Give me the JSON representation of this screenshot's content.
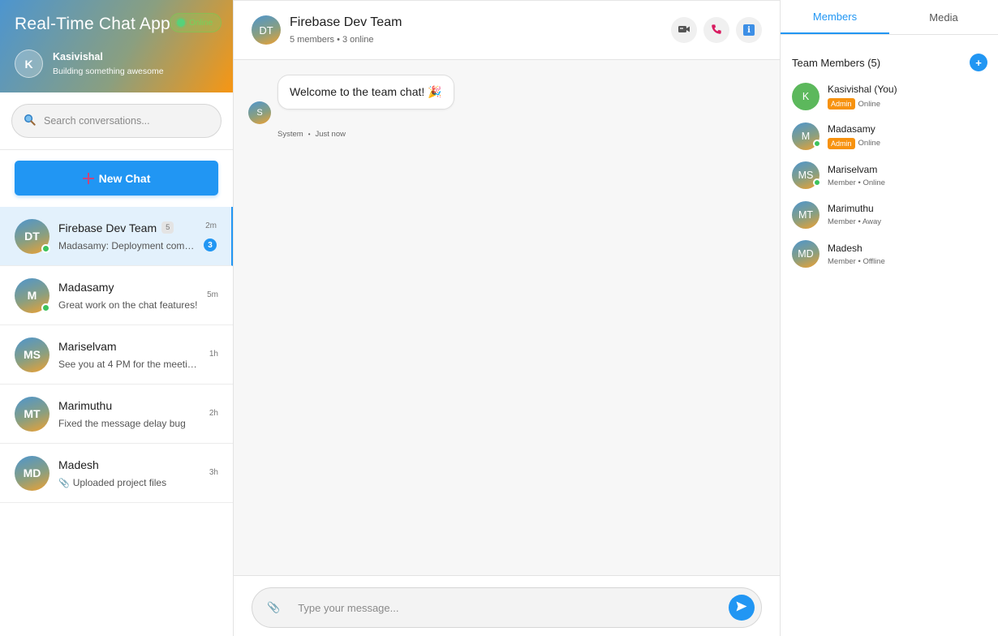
{
  "app": {
    "title": "Real-Time Chat App",
    "connection_status": "Online",
    "user": {
      "initial": "K",
      "name": "Kasivishal",
      "status": "Building something awesome"
    }
  },
  "search": {
    "placeholder": "Search conversations..."
  },
  "new_chat": {
    "label": "New Chat"
  },
  "conversations": [
    {
      "initials": "DT",
      "name": "Firebase Dev Team",
      "member_count": "5",
      "last_message": "Madasamy: Deployment comp...",
      "time": "2m",
      "unread": "3",
      "online": true,
      "active": true
    },
    {
      "initials": "M",
      "name": "Madasamy",
      "last_message": "Great work on the chat features!",
      "time": "5m",
      "online": true
    },
    {
      "initials": "MS",
      "name": "Mariselvam",
      "last_message": "See you at 4 PM for the meeting",
      "time": "1h"
    },
    {
      "initials": "MT",
      "name": "Marimuthu",
      "last_message": "Fixed the message delay bug",
      "time": "2h"
    },
    {
      "initials": "MD",
      "name": "Madesh",
      "last_message": "Uploaded project files",
      "time": "3h"
    }
  ],
  "chat": {
    "initials": "DT",
    "name": "Firebase Dev Team",
    "subtitle": "5 members • 3 online",
    "messages": [
      {
        "sender_initial": "S",
        "text": "Welcome to the team chat! 🎉",
        "sender": "System",
        "time": "Just now"
      }
    ],
    "composer_placeholder": "Type your message..."
  },
  "panel": {
    "tabs": [
      "Members",
      "Media"
    ],
    "members_title": "Team Members (5)",
    "members": [
      {
        "initials": "K",
        "name": "Kasivishal (You)",
        "badge": "Admin",
        "status": "Online"
      },
      {
        "initials": "M",
        "name": "Madasamy",
        "badge": "Admin",
        "status": "Online"
      },
      {
        "initials": "MS",
        "name": "Mariselvam",
        "status": "Member • Online"
      },
      {
        "initials": "MT",
        "name": "Marimuthu",
        "status": "Member • Away"
      },
      {
        "initials": "MD",
        "name": "Madesh",
        "status": "Member • Offline"
      }
    ]
  },
  "colors": {
    "accent": "#2196f3",
    "admin_badge": "#f7920f",
    "online": "#3ec25c"
  },
  "icons": {
    "search": "search-icon",
    "new_chat": "plus-icon",
    "video": "video-camera-icon",
    "call": "phone-icon",
    "info": "info-icon",
    "attach": "paperclip-icon",
    "send": "send-icon",
    "add_member": "plus-icon"
  }
}
